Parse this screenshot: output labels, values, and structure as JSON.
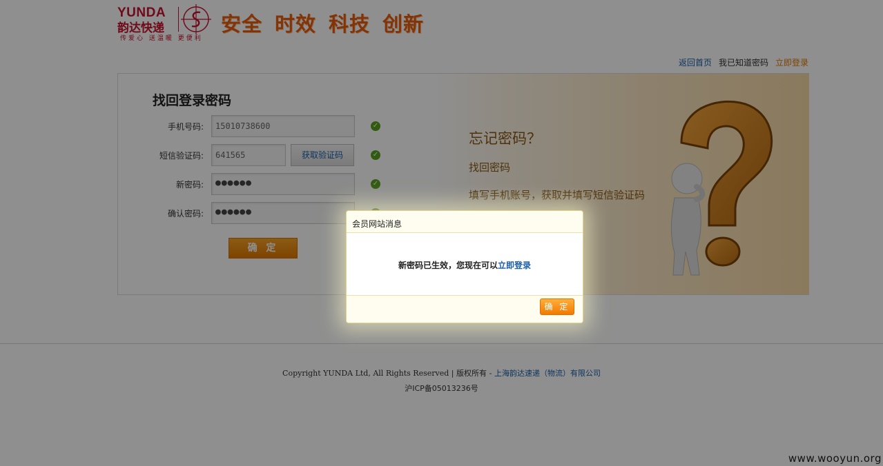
{
  "header": {
    "logo_en": "YUNDA",
    "logo_cn": "韵达快递",
    "logo_tagline": "传爱心 送温暖 更便利",
    "slogans": [
      "安全",
      "时效",
      "科技",
      "创新"
    ]
  },
  "toplinks": {
    "home": "返回首页",
    "know_password": "我已知道密码",
    "login_now": "立即登录"
  },
  "form": {
    "title": "找回登录密码",
    "phone_label": "手机号码:",
    "phone_value": "15010738600",
    "sms_label": "短信验证码:",
    "sms_value": "641565",
    "sms_button": "获取验证码",
    "new_pwd_label": "新密码:",
    "new_pwd_value": "●●●●●●",
    "confirm_pwd_label": "确认密码:",
    "confirm_pwd_value": "●●●●●●",
    "submit": "确 定",
    "check_glyph": "✓"
  },
  "art": {
    "title": "忘记密码？",
    "line1": "找回密码",
    "line2": "填写手机账号，获取并填写短信验证码"
  },
  "footer": {
    "copyright": "Copyright YUNDA Ltd, All Rights Reserved",
    "separator": " | ",
    "rights": "版权所有 - ",
    "company": "上海韵达速递（物流）有限公司",
    "icp": "沪ICP备05013236号"
  },
  "watermark": "www.wooyun.org",
  "dialog": {
    "title": "会员网站消息",
    "message_prefix": "新密码已生效，您现在可以",
    "message_link": "立即登录",
    "ok": "确 定"
  },
  "colors": {
    "brand_red": "#c8102e",
    "accent_orange": "#e85d0b",
    "link_blue": "#1a5ea8",
    "check_green": "#5aa21f"
  }
}
